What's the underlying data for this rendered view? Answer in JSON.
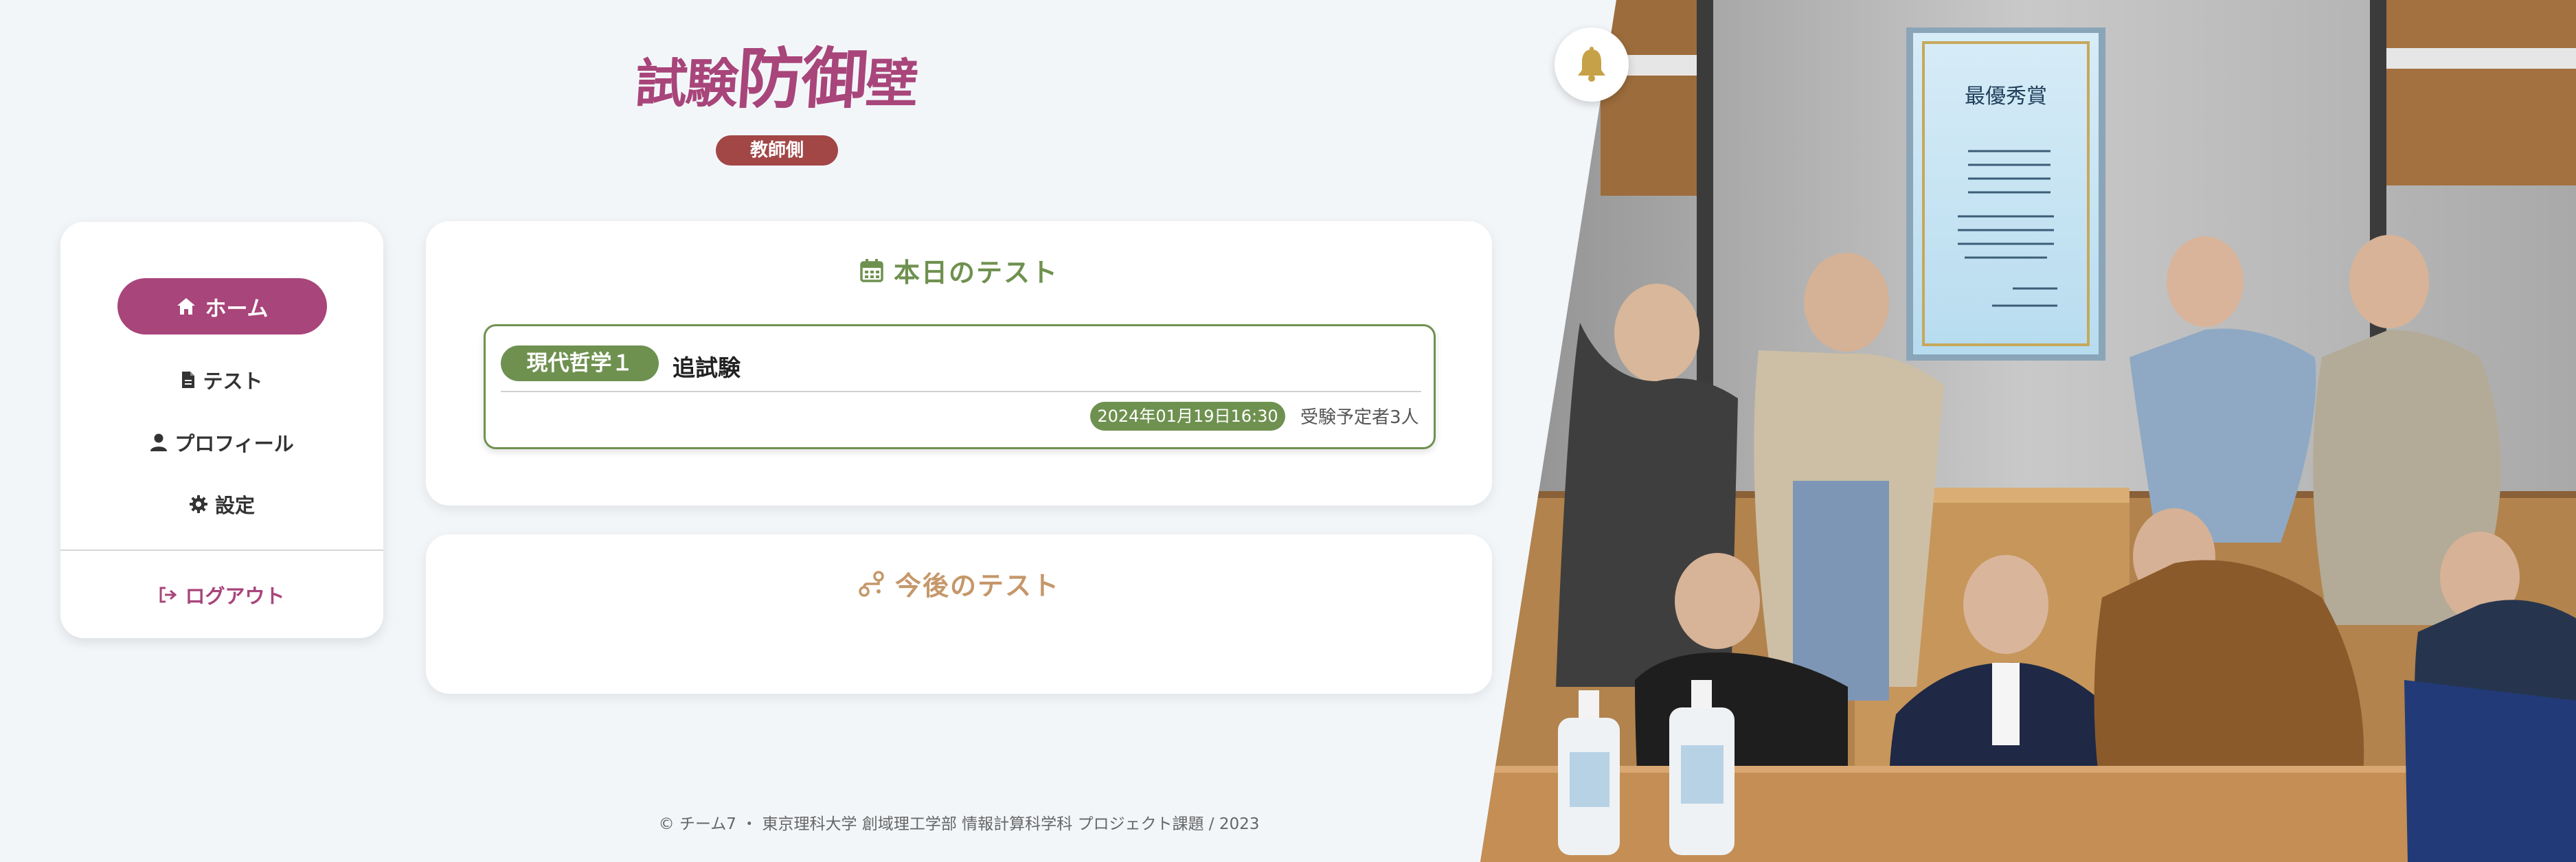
{
  "header": {
    "brand_part1": "試験",
    "brand_part2": "防御",
    "brand_part3": "壁",
    "role_badge": "教師側"
  },
  "sidebar": {
    "items": [
      {
        "label": "ホーム",
        "icon": "home-icon",
        "active": true
      },
      {
        "label": "テスト",
        "icon": "file-icon",
        "active": false
      },
      {
        "label": "プロフィール",
        "icon": "user-icon",
        "active": false
      },
      {
        "label": "設定",
        "icon": "gear-icon",
        "active": false
      }
    ],
    "logout": {
      "label": "ログアウト",
      "icon": "logout-icon"
    }
  },
  "today": {
    "title": "本日のテスト",
    "icon": "calendar-icon",
    "tests": [
      {
        "subject": "現代哲学１",
        "name": "追試験",
        "datetime": "2024年01月19日16:30",
        "examinees": "受験予定者3人"
      }
    ]
  },
  "future": {
    "title": "今後のテスト",
    "icon": "route-icon"
  },
  "footer": {
    "text": "© チーム7 ・ 東京理科大学 創域理工学部 情報計算科学科 プロジェクト課題 / 2023"
  },
  "notification": {
    "icon": "bell-icon"
  },
  "photo": {
    "certificate_title": "最優秀賞"
  },
  "colors": {
    "accent": "#a8457a",
    "green": "#6f9150",
    "orange": "#c5976a",
    "badge_red": "#a24646",
    "bg": "#f3f6f9"
  }
}
